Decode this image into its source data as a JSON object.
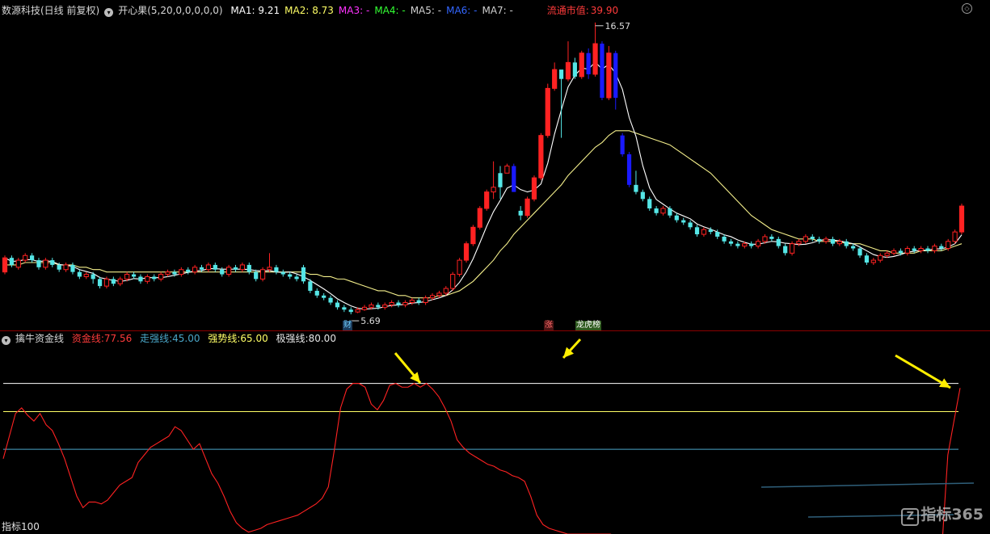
{
  "header": {
    "stock_name": "数源科技(日线 前复权)",
    "indicator_name": "开心果",
    "indicator_params": "(5,20,0,0,0,0,0)",
    "ma": [
      {
        "label": "MA1:",
        "value": "9.21",
        "color": "#ffffff"
      },
      {
        "label": "MA2:",
        "value": "8.73",
        "color": "#ffff66"
      },
      {
        "label": "MA3:",
        "value": "-",
        "color": "#ff33ff"
      },
      {
        "label": "MA4:",
        "value": "-",
        "color": "#33ff33"
      },
      {
        "label": "MA5:",
        "value": "-",
        "color": "#d0d0d0"
      },
      {
        "label": "MA6:",
        "value": "-",
        "color": "#3366ff"
      },
      {
        "label": "MA7:",
        "value": "-",
        "color": "#d0d0d0"
      }
    ],
    "market_cap_label": "流通市值:",
    "market_cap_value": "39.90"
  },
  "sub_header": {
    "name": "擒牛资金线",
    "fund_label": "资金线:",
    "fund_value": "77.56",
    "weak_label": "走强线:",
    "weak_value": "45.00",
    "strong_label": "强势线:",
    "strong_value": "65.00",
    "extreme_label": "极强线:",
    "extreme_value": "80.00"
  },
  "badges": {
    "cai": "财",
    "zhang": "涨",
    "longhu": "龙虎榜"
  },
  "footer": {
    "indicator_tab": "指标100",
    "watermark": "指标365"
  },
  "colors": {
    "up": "#ff2222",
    "down": "#55e6e6",
    "strong_down": "#1a1aff",
    "ma1": "#ffffff",
    "ma2": "#f5f08c",
    "fund_line": "#ff2222",
    "weak_line": "#4aa6c8",
    "strong_line": "#ffff66",
    "extreme_line": "#ffffff",
    "arrow": "#ffee00"
  },
  "chart_data": [
    {
      "type": "candlestick",
      "title": "数源科技(日线 前复权)",
      "price_range": [
        4.7,
        17.4
      ],
      "annotations": [
        {
          "text": "16.57",
          "kind": "high",
          "value": 16.57
        },
        {
          "text": "5.69",
          "kind": "low",
          "value": 5.69
        }
      ],
      "candles": [
        [
          6.6,
          7.2,
          6.5,
          7.3,
          6.9
        ],
        [
          7.2,
          6.9,
          6.8,
          7.3,
          6.9
        ],
        [
          6.8,
          7.1,
          6.7,
          7.2,
          6.9
        ],
        [
          7.1,
          7.3,
          7.0,
          7.4,
          7.0
        ],
        [
          7.3,
          7.1,
          7.0,
          7.4,
          7.0
        ],
        [
          7.1,
          6.8,
          6.7,
          7.2,
          7.0
        ],
        [
          6.8,
          7.1,
          6.7,
          7.2,
          7.0
        ],
        [
          7.1,
          6.9,
          6.8,
          7.2,
          7.0
        ],
        [
          6.9,
          6.7,
          6.6,
          7.0,
          6.9
        ],
        [
          6.7,
          6.9,
          6.6,
          7.0,
          6.9
        ],
        [
          6.9,
          6.6,
          6.5,
          7.0,
          6.9
        ],
        [
          6.6,
          6.4,
          6.3,
          6.7,
          6.8
        ],
        [
          6.4,
          6.5,
          6.3,
          6.6,
          6.8
        ],
        [
          6.5,
          6.3,
          6.1,
          6.6,
          6.7
        ],
        [
          6.3,
          6.0,
          5.9,
          6.4,
          6.7
        ],
        [
          6.0,
          6.3,
          5.9,
          6.4,
          6.6
        ],
        [
          6.3,
          6.1,
          6.0,
          6.4,
          6.6
        ],
        [
          6.1,
          6.3,
          6.0,
          6.4,
          6.6
        ],
        [
          6.3,
          6.5,
          6.2,
          6.6,
          6.6
        ],
        [
          6.5,
          6.4,
          6.3,
          6.6,
          6.6
        ],
        [
          6.4,
          6.2,
          6.1,
          6.5,
          6.6
        ],
        [
          6.2,
          6.4,
          6.1,
          6.5,
          6.6
        ],
        [
          6.4,
          6.3,
          6.2,
          6.5,
          6.6
        ],
        [
          6.3,
          6.5,
          6.2,
          6.6,
          6.6
        ],
        [
          6.5,
          6.6,
          6.4,
          6.7,
          6.6
        ],
        [
          6.6,
          6.5,
          6.4,
          6.7,
          6.6
        ],
        [
          6.5,
          6.7,
          6.4,
          6.8,
          6.6
        ],
        [
          6.7,
          6.6,
          6.5,
          6.8,
          6.6
        ],
        [
          6.6,
          6.8,
          6.5,
          6.9,
          6.6
        ],
        [
          6.8,
          6.7,
          6.6,
          6.9,
          6.6
        ],
        [
          6.7,
          6.9,
          6.6,
          7.0,
          6.6
        ],
        [
          6.9,
          6.7,
          6.6,
          7.0,
          6.6
        ],
        [
          6.7,
          6.5,
          6.4,
          6.8,
          6.6
        ],
        [
          6.5,
          6.8,
          6.4,
          6.9,
          6.6
        ],
        [
          6.8,
          6.7,
          6.6,
          6.9,
          6.6
        ],
        [
          6.7,
          6.9,
          6.6,
          7.0,
          6.6
        ],
        [
          6.9,
          6.6,
          6.5,
          7.0,
          6.6
        ],
        [
          6.6,
          6.3,
          6.2,
          6.7,
          6.6
        ],
        [
          6.3,
          6.7,
          6.2,
          6.8,
          6.6
        ],
        [
          6.7,
          6.8,
          6.6,
          7.4,
          6.6
        ],
        [
          6.8,
          6.6,
          6.5,
          6.9,
          6.6
        ],
        [
          6.6,
          6.5,
          6.4,
          6.7,
          6.6
        ],
        [
          6.5,
          6.4,
          6.3,
          6.6,
          6.6
        ],
        [
          6.4,
          6.3,
          6.2,
          6.5,
          6.6
        ],
        [
          6.8,
          6.2,
          6.1,
          6.9,
          6.6
        ],
        [
          6.2,
          5.8,
          5.7,
          6.3,
          6.5
        ],
        [
          5.8,
          5.6,
          5.5,
          5.9,
          6.5
        ],
        [
          5.6,
          5.5,
          5.4,
          5.7,
          6.4
        ],
        [
          5.5,
          5.3,
          5.2,
          5.6,
          6.4
        ],
        [
          5.3,
          5.1,
          5.0,
          5.4,
          6.3
        ],
        [
          5.1,
          5.0,
          4.9,
          5.2,
          6.3
        ],
        [
          5.0,
          4.9,
          4.8,
          5.1,
          6.2
        ],
        [
          4.9,
          5.0,
          4.85,
          5.1,
          6.1
        ],
        [
          5.0,
          5.1,
          4.95,
          5.2,
          6.0
        ],
        [
          5.1,
          5.2,
          5.0,
          5.3,
          5.9
        ],
        [
          5.2,
          5.1,
          5.0,
          5.3,
          5.8
        ],
        [
          5.1,
          5.2,
          5.0,
          5.3,
          5.8
        ],
        [
          5.2,
          5.3,
          5.1,
          5.4,
          5.7
        ],
        [
          5.3,
          5.2,
          5.1,
          5.4,
          5.6
        ],
        [
          5.2,
          5.3,
          5.1,
          5.4,
          5.6
        ],
        [
          5.3,
          5.4,
          5.2,
          5.5,
          5.5
        ],
        [
          5.4,
          5.3,
          5.2,
          5.5,
          5.5
        ],
        [
          5.3,
          5.5,
          5.2,
          5.6,
          5.5
        ],
        [
          5.5,
          5.6,
          5.4,
          5.7,
          5.5
        ],
        [
          5.6,
          5.7,
          5.5,
          5.8,
          5.6
        ],
        [
          5.7,
          5.9,
          5.6,
          6.0,
          5.6
        ],
        [
          5.9,
          6.5,
          5.8,
          6.6,
          5.7
        ],
        [
          6.5,
          7.1,
          6.4,
          7.2,
          5.8
        ],
        [
          7.1,
          7.8,
          7.0,
          7.9,
          6.0
        ],
        [
          7.8,
          8.5,
          7.7,
          8.6,
          6.2
        ],
        [
          8.5,
          9.3,
          8.4,
          9.4,
          6.5
        ],
        [
          9.3,
          10.0,
          9.2,
          10.1,
          6.8
        ],
        [
          10.0,
          10.2,
          9.7,
          11.3,
          7.1
        ],
        [
          10.8,
          10.2,
          9.7,
          11.1,
          7.5
        ],
        [
          10.8,
          11.1,
          10.8,
          11.2,
          7.8
        ],
        [
          11.1,
          10.0,
          10.0,
          11.2,
          8.2
        ],
        [
          9.2,
          9.0,
          8.8,
          9.4,
          8.5
        ],
        [
          9.0,
          9.7,
          8.9,
          9.8,
          8.8
        ],
        [
          9.7,
          10.6,
          9.6,
          10.7,
          9.1
        ],
        [
          10.6,
          12.4,
          10.5,
          12.5,
          9.4
        ],
        [
          12.4,
          14.4,
          12.3,
          14.6,
          9.7
        ],
        [
          14.4,
          15.2,
          14.3,
          15.5,
          10.0
        ],
        [
          15.2,
          14.8,
          12.3,
          15.0,
          10.3
        ],
        [
          14.8,
          15.5,
          14.7,
          16.4,
          10.7
        ],
        [
          15.5,
          14.9,
          14.8,
          15.7,
          11.0
        ],
        [
          14.9,
          15.9,
          14.8,
          16.0,
          11.3
        ],
        [
          15.9,
          15.0,
          14.8,
          16.1,
          11.6
        ],
        [
          15.0,
          16.3,
          14.9,
          17.2,
          11.9
        ],
        [
          16.3,
          14.0,
          13.9,
          16.4,
          12.1
        ],
        [
          14.0,
          15.9,
          13.9,
          16.2,
          12.4
        ],
        [
          15.9,
          14.0,
          13.5,
          16.0,
          12.6
        ],
        [
          12.4,
          11.6,
          11.5,
          12.5,
          12.6
        ],
        [
          11.6,
          10.3,
          10.2,
          11.7,
          12.6
        ],
        [
          10.3,
          10.0,
          9.9,
          10.9,
          12.5
        ],
        [
          10.0,
          9.7,
          9.6,
          10.1,
          12.4
        ],
        [
          9.7,
          9.3,
          9.2,
          9.8,
          12.3
        ],
        [
          9.3,
          9.1,
          9.0,
          9.4,
          12.2
        ],
        [
          9.1,
          9.3,
          9.0,
          9.4,
          12.1
        ],
        [
          9.3,
          9.0,
          8.9,
          9.4,
          12.0
        ],
        [
          9.0,
          8.8,
          8.7,
          9.1,
          11.8
        ],
        [
          8.8,
          8.7,
          8.6,
          8.9,
          11.6
        ],
        [
          8.7,
          8.5,
          8.4,
          8.8,
          11.4
        ],
        [
          8.5,
          8.2,
          8.1,
          8.6,
          11.2
        ],
        [
          8.2,
          8.4,
          8.1,
          8.5,
          11.0
        ],
        [
          8.4,
          8.3,
          8.2,
          8.5,
          10.8
        ],
        [
          8.3,
          8.1,
          8.0,
          8.4,
          10.5
        ],
        [
          8.1,
          7.9,
          7.8,
          8.2,
          10.2
        ],
        [
          7.9,
          7.8,
          7.7,
          8.0,
          9.9
        ],
        [
          7.8,
          7.7,
          7.6,
          7.9,
          9.6
        ],
        [
          7.7,
          7.8,
          7.6,
          7.9,
          9.3
        ],
        [
          7.8,
          7.7,
          7.6,
          7.9,
          9.0
        ],
        [
          7.7,
          7.9,
          7.6,
          8.0,
          8.8
        ],
        [
          7.9,
          8.1,
          7.8,
          8.2,
          8.6
        ],
        [
          8.1,
          8.0,
          7.9,
          8.2,
          8.4
        ],
        [
          8.0,
          7.7,
          7.6,
          8.1,
          8.3
        ],
        [
          7.7,
          7.4,
          7.3,
          7.8,
          8.2
        ],
        [
          7.4,
          7.8,
          7.3,
          7.9,
          8.1
        ],
        [
          7.8,
          7.9,
          7.7,
          8.0,
          8.0
        ],
        [
          7.9,
          8.1,
          7.8,
          8.2,
          8.0
        ],
        [
          8.1,
          8.0,
          7.9,
          8.2,
          8.0
        ],
        [
          8.0,
          7.9,
          7.8,
          8.1,
          7.9
        ],
        [
          7.9,
          8.0,
          7.8,
          8.1,
          7.9
        ],
        [
          8.0,
          7.8,
          7.7,
          8.1,
          7.9
        ],
        [
          7.8,
          7.9,
          7.7,
          8.0,
          7.9
        ],
        [
          7.9,
          7.7,
          7.6,
          8.0,
          7.8
        ],
        [
          7.7,
          7.6,
          7.5,
          7.8,
          7.8
        ],
        [
          7.6,
          7.3,
          7.2,
          7.7,
          7.8
        ],
        [
          7.3,
          7.0,
          6.9,
          7.4,
          7.7
        ],
        [
          7.0,
          7.1,
          6.9,
          7.2,
          7.6
        ],
        [
          7.1,
          7.3,
          7.0,
          7.4,
          7.5
        ],
        [
          7.3,
          7.4,
          7.2,
          7.5,
          7.5
        ],
        [
          7.4,
          7.5,
          7.3,
          7.6,
          7.4
        ],
        [
          7.5,
          7.4,
          7.3,
          7.6,
          7.4
        ],
        [
          7.4,
          7.6,
          7.3,
          7.7,
          7.4
        ],
        [
          7.6,
          7.5,
          7.4,
          7.7,
          7.4
        ],
        [
          7.5,
          7.6,
          7.4,
          7.7,
          7.5
        ],
        [
          7.6,
          7.5,
          7.4,
          7.7,
          7.5
        ],
        [
          7.5,
          7.7,
          7.4,
          7.8,
          7.5
        ],
        [
          7.7,
          7.6,
          7.5,
          7.8,
          7.5
        ],
        [
          7.6,
          7.9,
          7.5,
          8.0,
          7.6
        ],
        [
          7.9,
          8.3,
          7.8,
          8.4,
          7.7
        ],
        [
          8.3,
          9.4,
          8.2,
          9.5,
          7.8
        ]
      ]
    },
    {
      "type": "line",
      "title": "擒牛资金线",
      "ylim": [
        0,
        100
      ],
      "reference_lines": [
        45,
        65,
        80
      ],
      "series": [
        {
          "name": "资金线",
          "values": [
            40,
            52,
            64,
            67,
            63,
            60,
            64,
            58,
            55,
            48,
            40,
            30,
            20,
            14,
            17,
            17,
            16,
            18,
            22,
            26,
            28,
            30,
            38,
            42,
            46,
            48,
            50,
            52,
            57,
            55,
            50,
            45,
            48,
            40,
            32,
            27,
            20,
            12,
            6,
            3,
            1,
            2,
            3,
            5,
            6,
            7,
            8,
            9,
            10,
            12,
            14,
            16,
            19,
            25,
            45,
            67,
            77,
            80,
            80,
            78,
            69,
            66,
            71,
            79,
            80,
            78,
            78,
            80,
            78,
            80,
            77,
            73,
            67,
            60,
            50,
            46,
            43,
            41,
            39,
            37,
            36,
            34,
            33,
            31,
            30,
            28,
            20,
            10,
            5,
            3,
            2,
            1,
            0,
            0,
            0,
            0,
            0,
            0,
            0,
            0,
            -2,
            -4,
            -6,
            -7,
            -8,
            -9,
            -9,
            -9,
            -9,
            -9,
            -9,
            -9,
            -9,
            -9,
            -9,
            -9,
            -9,
            -9,
            -9,
            -9,
            -9,
            -9,
            -9,
            -9,
            -9,
            -9,
            -9,
            -9,
            -9,
            -9,
            -9,
            -9,
            -9,
            -9,
            -9,
            -9,
            -9,
            -9,
            -9,
            -9,
            -9,
            -9,
            -9,
            -9,
            -9,
            -9,
            -9,
            -9,
            -9,
            -9,
            -9,
            -9,
            -9,
            -9,
            42,
            60,
            77.56
          ]
        },
        {
          "name": "走强线",
          "values": [
            45
          ]
        },
        {
          "name": "强势线",
          "values": [
            65
          ]
        },
        {
          "name": "极强线",
          "values": [
            80
          ]
        }
      ]
    }
  ]
}
